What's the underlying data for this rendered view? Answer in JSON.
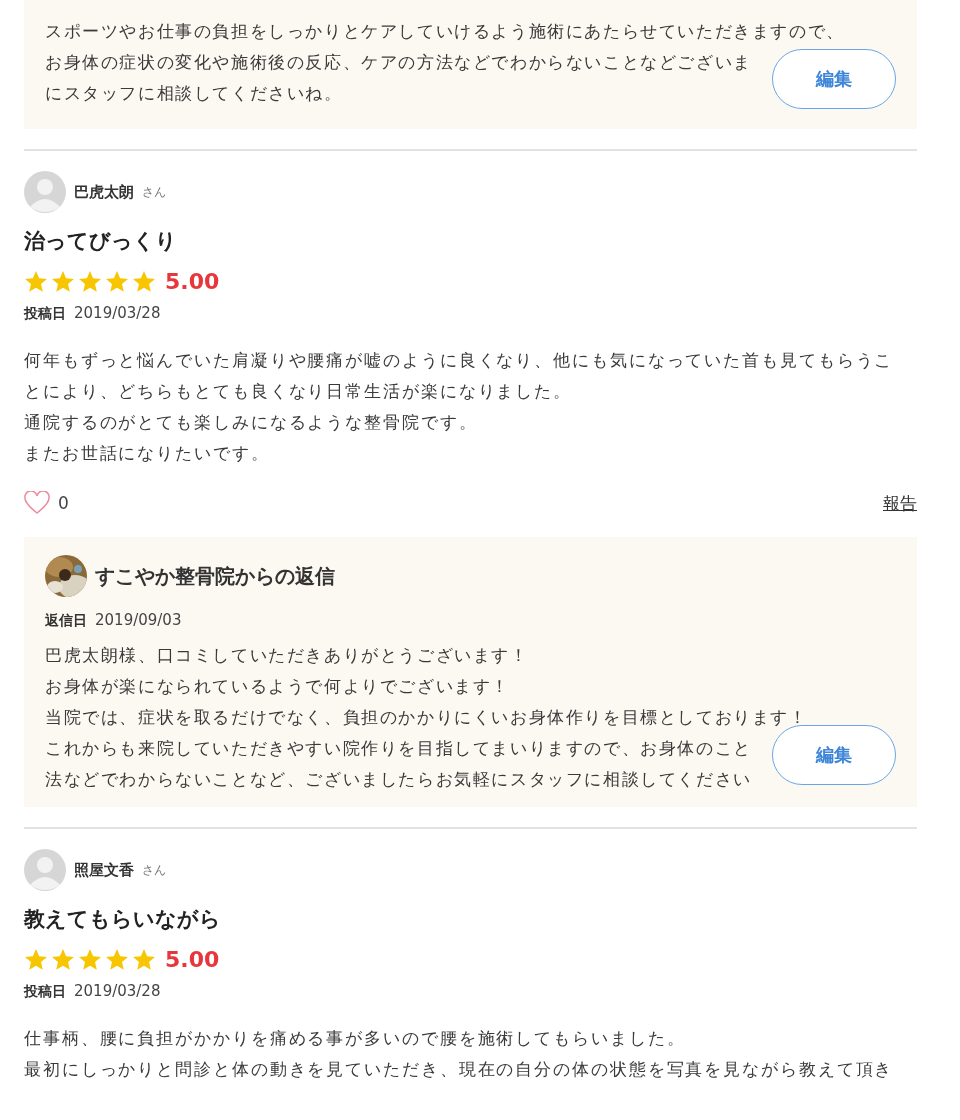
{
  "top_reply": {
    "lines": [
      "スポーツやお仕事の負担をしっかりとケアしていけるよう施術にあたらせていただきますので、",
      "お身体の症状の変化や施術後の反応、ケアの方法などでわからないことなどございま",
      "にスタッフに相談してくださいね。"
    ],
    "edit_button": "編集"
  },
  "reviews": [
    {
      "user": "巴虎太朗",
      "honorific": "さん",
      "title": "治ってびっくり",
      "stars": 5,
      "score": "5.00",
      "posted_label": "投稿日",
      "posted_date": "2019/03/28",
      "body": [
        "何年もずっと悩んでいた肩凝りや腰痛が嘘のように良くなり、他にも気になっていた首も見てもらうこ",
        "とにより、どちらもとても良くなり日常生活が楽になりました。",
        "通院するのがとても楽しみになるような整骨院です。",
        "またお世話になりたいです。"
      ],
      "likes": "0",
      "liked": false,
      "report": "報告",
      "reply": {
        "from": "すこやか整骨院からの返信",
        "date_label": "返信日",
        "date": "2019/09/03",
        "lines": [
          "巴虎太朗様、口コミしていただきありがとうございます！",
          "お身体が楽になられているようで何よりでございます！",
          "当院では、症状を取るだけでなく、負担のかかりにくいお身体作りを目標としております！",
          "これからも来院していただきやすい院作りを目指してまいりますので、お身体のこと",
          "法などでわからないことなど、ございましたらお気軽にスタッフに相談してください"
        ],
        "edit_button": "編集"
      }
    },
    {
      "user": "照屋文香",
      "honorific": "さん",
      "title": "教えてもらいながら",
      "stars": 5,
      "score": "5.00",
      "posted_label": "投稿日",
      "posted_date": "2019/03/28",
      "body": [
        "仕事柄、腰に負担がかかりを痛める事が多いので腰を施術してもらいました。",
        "最初にしっかりと問診と体の動きを見ていただき、現在の自分の体の状態を写真を見ながら教えて頂き"
      ]
    }
  ]
}
